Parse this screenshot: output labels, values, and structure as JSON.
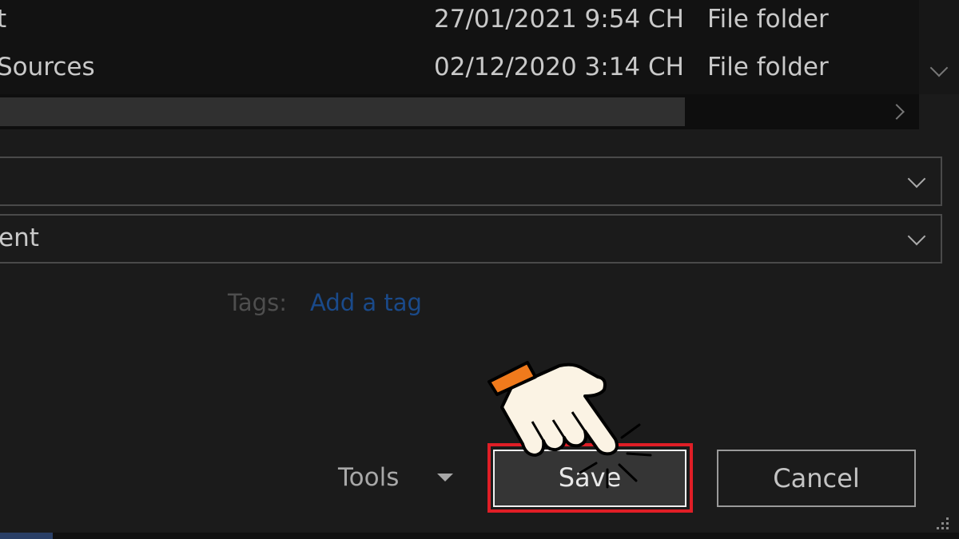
{
  "file_list": {
    "rows": [
      {
        "name": "t",
        "date": "27/01/2021 9:54 CH",
        "type": "File folder"
      },
      {
        "name": "Sources",
        "date": "02/12/2020 3:14 CH",
        "type": "File folder"
      }
    ]
  },
  "filename_field": {
    "value": ""
  },
  "save_type_field": {
    "value": "ent"
  },
  "tags": {
    "label": "Tags:",
    "link": "Add a tag"
  },
  "footer": {
    "tools_label": "Tools",
    "save_label": "Save",
    "cancel_label": "Cancel"
  },
  "colors": {
    "background": "#1b1b1b",
    "highlight": "#e01e26",
    "link": "#1a4a8a",
    "cuff": "#f07a1c"
  },
  "icons": [
    "chevron-down-icon",
    "chevron-right-icon",
    "caret-down-icon",
    "resize-grip-icon",
    "pointing-hand-icon"
  ]
}
